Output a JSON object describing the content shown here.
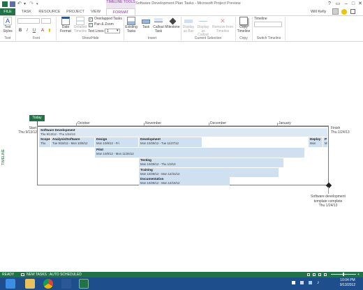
{
  "title_bar": {
    "context_tab_group": "TIMELINE TOOLS",
    "window_title": "Software Development Plan Tasks - Microsoft Project Preview"
  },
  "tabs": [
    "FILE",
    "TASK",
    "RESOURCE",
    "PROJECT",
    "VIEW",
    "FORMAT"
  ],
  "active_tab": "FORMAT",
  "user_name": "Will Kelly",
  "ribbon": {
    "groups": {
      "text": "Text",
      "font": "Font",
      "show_hide": "Show/Hide",
      "insert": "Insert",
      "current_selection": "Current Selection",
      "copy": "Copy",
      "switch_timeline": "Switch Timeline"
    },
    "text_styles": "Text Styles",
    "font_buttons": [
      "B",
      "I",
      "U"
    ],
    "date_format": "Date Format",
    "detailed_timeline": "Detailed Timeline",
    "overlapped_tasks": "Overlapped Tasks",
    "pan_zoom": "Pan & Zoom",
    "text_lines_label": "Text Lines:",
    "text_lines_value": "1",
    "existing_tasks": "Existing Tasks",
    "task": "Task",
    "callout_task": "Callout Task",
    "milestone": "Milestone",
    "display_as_bar": "Display as Bar",
    "display_as_callout": "Display as Callout",
    "remove_from_timeline": "Remove from Timeline",
    "copy_timeline": "Copy Timeline",
    "timeline_label": "Timeline"
  },
  "timeline": {
    "side_label": "TIMELINE",
    "today": "Today",
    "months": [
      "October",
      "November",
      "December",
      "January"
    ],
    "start_label": "Start",
    "start_date": "Thu 9/13/12",
    "finish_label": "Finish",
    "finish_date": "Thu 1/24/13",
    "bars": {
      "software_development": {
        "name": "Software Development",
        "dates": "Thu 9/13/12 - Thu 1/24/13"
      },
      "scope": {
        "name": "Scope",
        "dates": "Thu"
      },
      "analysis": {
        "name": "Analysis/Software",
        "dates": "Tue 9/18/12 - Mon 10/8/12"
      },
      "design": {
        "name": "Design",
        "dates": "Mon 10/8/12 - Fri"
      },
      "pilot": {
        "name": "Pilot",
        "dates": "Mon 10/8/12 - Mon 11/26/12"
      },
      "development": {
        "name": "Development",
        "dates": "Mon 10/29/12 - Tue 11/27/12"
      },
      "deploy": {
        "name": "Deploy",
        "dates": "Mon"
      },
      "post": {
        "name": "P",
        "dates": "M"
      },
      "testing": {
        "name": "Testing",
        "dates": "Mon 10/29/12 - Thu 1/3/13"
      },
      "training": {
        "name": "Training",
        "dates": "Mon 10/29/12 - Mon 12/31/12"
      },
      "documentation": {
        "name": "Documentation",
        "dates": "Mon 10/29/12 - Mon 12/10/12"
      }
    },
    "milestone": {
      "name": "Software development template complete",
      "date": "Thu 1/24/13"
    }
  },
  "status_bar": {
    "ready": "READY",
    "new_tasks": "NEW TASKS : AUTO SCHEDULED"
  },
  "clock": {
    "time": "10:04 PM",
    "date": "9/13/2012"
  },
  "colors": {
    "accent_green": "#217346",
    "context_purple": "#8a3fa6",
    "bar_fill": "#cfe0f0",
    "taskbar": "#1e4f8c"
  }
}
